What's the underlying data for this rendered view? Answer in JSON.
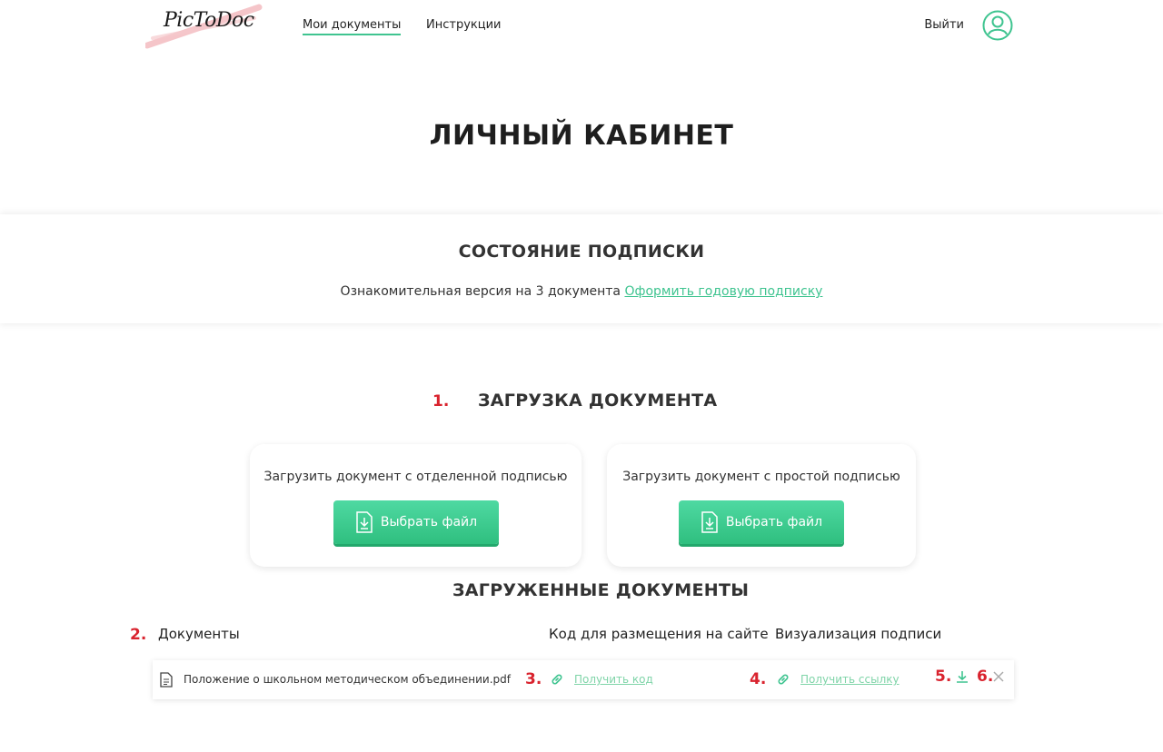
{
  "header": {
    "logo": "PicToDoc",
    "nav": [
      {
        "label": "Мои документы"
      },
      {
        "label": "Инструкции"
      }
    ],
    "logout": "Выйти"
  },
  "page_title": "ЛИЧНЫЙ КАБИНЕТ",
  "subscription": {
    "title": "СОСТОЯНИЕ ПОДПИСКИ",
    "text": "Ознакомительная версия на 3 документа",
    "link": "Оформить годовую подписку"
  },
  "upload": {
    "step": "1.",
    "title": "ЗАГРУЗКА ДОКУМЕНТА",
    "cards": [
      {
        "label": "Загрузить документ с отделенной подписью",
        "button": "Выбрать файл"
      },
      {
        "label": "Загрузить документ с простой подписью",
        "button": "Выбрать файл"
      }
    ]
  },
  "uploaded": {
    "title": "ЗАГРУЖЕННЫЕ ДОКУМЕНТЫ",
    "step": "2.",
    "columns": [
      "Документы",
      "Код для размещения на сайте",
      "Визуализация подписи"
    ],
    "rows": [
      {
        "name": "Положение о школьном методическом объединении.pdf",
        "code_step": "3.",
        "code_link": "Получить код",
        "viz_step": "4.",
        "viz_link": "Получить ссылку",
        "download_step": "5.",
        "delete_step": "6."
      }
    ]
  },
  "colors": {
    "accent": "#3fc490",
    "marker": "#d9232e"
  }
}
